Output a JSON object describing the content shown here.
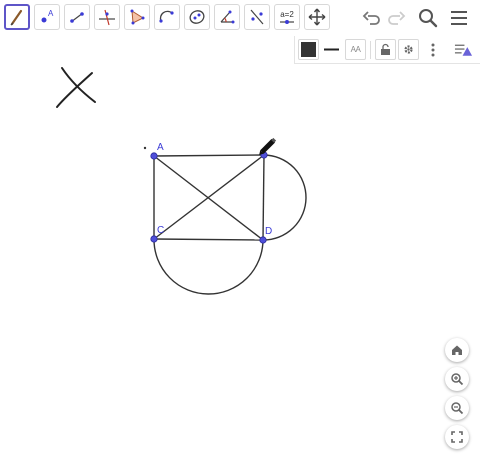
{
  "toolbar": {
    "tools": [
      {
        "name": "pen-tool",
        "active": true
      },
      {
        "name": "point-tool",
        "label": "A"
      },
      {
        "name": "line-tool"
      },
      {
        "name": "perpendicular-line-tool"
      },
      {
        "name": "polygon-tool"
      },
      {
        "name": "semicircle-tool"
      },
      {
        "name": "conic-tool"
      },
      {
        "name": "angle-tool"
      },
      {
        "name": "reflect-tool"
      },
      {
        "name": "slider-tool",
        "label": "a=2"
      },
      {
        "name": "move-graphics-view-tool"
      }
    ],
    "undo_icon": "undo-icon",
    "redo_icon": "redo-icon",
    "search_icon": "search-icon",
    "menu_icon": "menu-icon"
  },
  "stylebar": {
    "color": "#333333",
    "text_size_label": "AA",
    "icons": [
      "color-swatch-icon",
      "line-style-icon",
      "text-size-icon",
      "lock-icon",
      "gear-icon",
      "more-vertical-icon",
      "algebra-view-toggle-icon"
    ]
  },
  "construction": {
    "points": {
      "A": "A",
      "C": "C",
      "D": "D"
    },
    "point_color": "#3b3bd6",
    "line_color": "#333333"
  },
  "zoom_controls": [
    "home-icon",
    "zoom-in-icon",
    "zoom-out-icon",
    "fullscreen-icon"
  ]
}
